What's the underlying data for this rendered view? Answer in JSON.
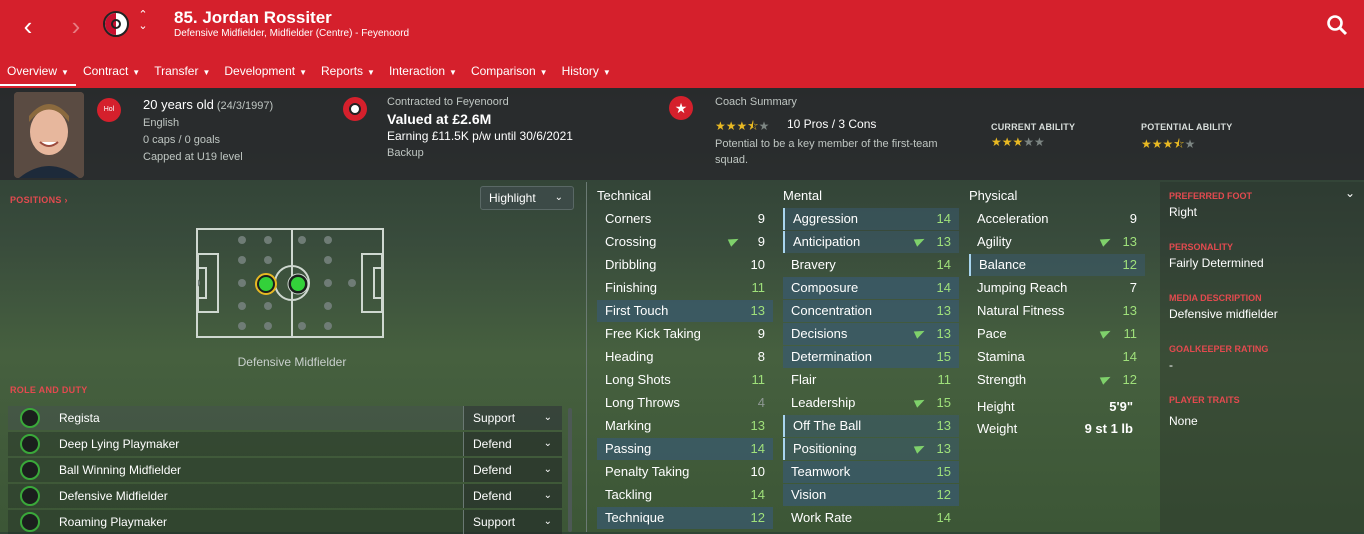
{
  "header": {
    "title": "85. Jordan Rossiter",
    "subtitle": "Defensive Midfielder, Midfielder (Centre) - Feyenoord"
  },
  "menu": [
    "Overview",
    "Contract",
    "Transfer",
    "Development",
    "Reports",
    "Interaction",
    "Comparison",
    "History"
  ],
  "player": {
    "role_badge": "Hol",
    "age": "20 years old",
    "dob": "(24/3/1997)",
    "nationality": "English",
    "caps": "0 caps / 0 goals",
    "capped_level": "Capped at U19 level"
  },
  "contract": {
    "club": "Contracted to Feyenoord",
    "value": "Valued at £2.6M",
    "earning": "Earning £11.5K p/w until 30/6/2021",
    "status": "Backup"
  },
  "coach": {
    "label": "Coach Summary",
    "pros_cons": "10 Pros / 3 Cons",
    "summary": "Potential to be a key member of the first-team squad.",
    "rating_stars": 3.5
  },
  "ability": {
    "current_label": "CURRENT ABILITY",
    "potential_label": "POTENTIAL ABILITY",
    "current_stars": 3,
    "potential_stars": 3.5
  },
  "positions": {
    "label": "POSITIONS",
    "position_name": "Defensive Midfielder",
    "highlight": "Highlight"
  },
  "roles": {
    "label": "ROLE AND DUTY",
    "items": [
      {
        "name": "Regista",
        "duty": "Support"
      },
      {
        "name": "Deep Lying Playmaker",
        "duty": "Defend"
      },
      {
        "name": "Ball Winning Midfielder",
        "duty": "Defend"
      },
      {
        "name": "Defensive Midfielder",
        "duty": "Defend"
      },
      {
        "name": "Roaming Playmaker",
        "duty": "Support"
      }
    ]
  },
  "technical": {
    "title": "Technical",
    "items": [
      {
        "name": "Corners",
        "value": "9"
      },
      {
        "name": "Crossing",
        "value": "9"
      },
      {
        "name": "Dribbling",
        "value": "10"
      },
      {
        "name": "Finishing",
        "value": "11"
      },
      {
        "name": "First Touch",
        "value": "13"
      },
      {
        "name": "Free Kick Taking",
        "value": "9"
      },
      {
        "name": "Heading",
        "value": "8"
      },
      {
        "name": "Long Shots",
        "value": "11"
      },
      {
        "name": "Long Throws",
        "value": "4"
      },
      {
        "name": "Marking",
        "value": "13"
      },
      {
        "name": "Passing",
        "value": "14"
      },
      {
        "name": "Penalty Taking",
        "value": "10"
      },
      {
        "name": "Tackling",
        "value": "14"
      },
      {
        "name": "Technique",
        "value": "12"
      }
    ]
  },
  "mental": {
    "title": "Mental",
    "items": [
      {
        "name": "Aggression",
        "value": "14"
      },
      {
        "name": "Anticipation",
        "value": "13"
      },
      {
        "name": "Bravery",
        "value": "14"
      },
      {
        "name": "Composure",
        "value": "14"
      },
      {
        "name": "Concentration",
        "value": "13"
      },
      {
        "name": "Decisions",
        "value": "13"
      },
      {
        "name": "Determination",
        "value": "15"
      },
      {
        "name": "Flair",
        "value": "11"
      },
      {
        "name": "Leadership",
        "value": "15"
      },
      {
        "name": "Off The Ball",
        "value": "13"
      },
      {
        "name": "Positioning",
        "value": "13"
      },
      {
        "name": "Teamwork",
        "value": "15"
      },
      {
        "name": "Vision",
        "value": "12"
      },
      {
        "name": "Work Rate",
        "value": "14"
      }
    ]
  },
  "physical": {
    "title": "Physical",
    "items": [
      {
        "name": "Acceleration",
        "value": "9"
      },
      {
        "name": "Agility",
        "value": "13"
      },
      {
        "name": "Balance",
        "value": "12"
      },
      {
        "name": "Jumping Reach",
        "value": "7"
      },
      {
        "name": "Natural Fitness",
        "value": "13"
      },
      {
        "name": "Pace",
        "value": "11"
      },
      {
        "name": "Stamina",
        "value": "14"
      },
      {
        "name": "Strength",
        "value": "12"
      }
    ],
    "height_label": "Height",
    "height": "5'9\"",
    "weight_label": "Weight",
    "weight": "9 st 1 lb"
  },
  "side": {
    "foot_label": "PREFERRED FOOT",
    "foot": "Right",
    "personality_label": "PERSONALITY",
    "personality": "Fairly Determined",
    "media_label": "MEDIA DESCRIPTION",
    "media": "Defensive midfielder",
    "gk_label": "GOALKEEPER RATING",
    "gk": "-",
    "traits_label": "PLAYER TRAITS",
    "traits": "None"
  },
  "colors": {
    "brand": "#d5202c",
    "good": "#9fe07a"
  }
}
